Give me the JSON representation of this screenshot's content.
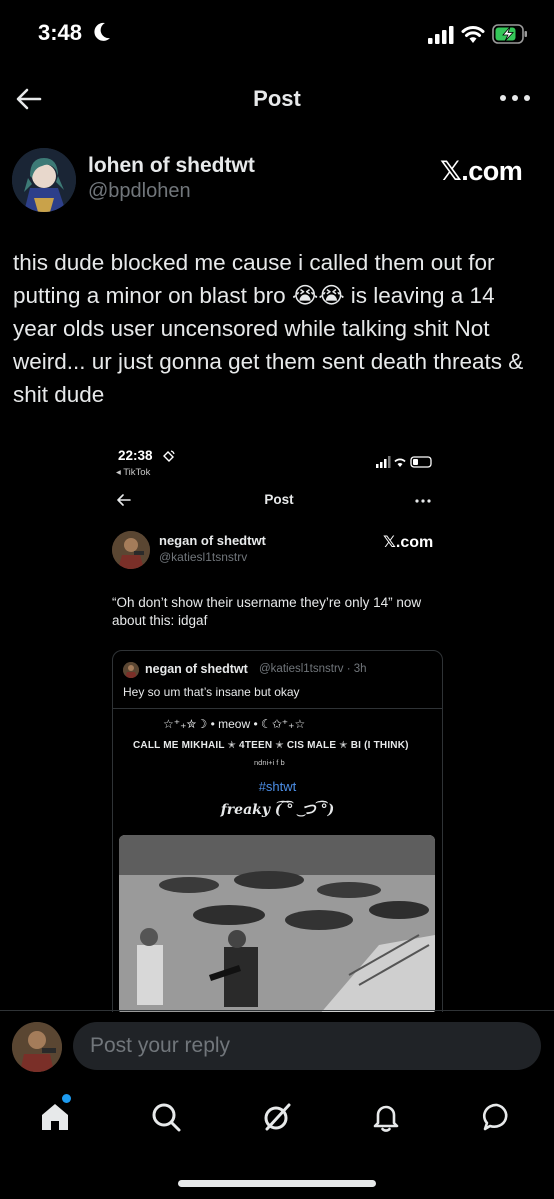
{
  "status_bar": {
    "time": "3:48"
  },
  "header": {
    "title": "Post"
  },
  "post": {
    "author_name": "lohen of shedtwt",
    "author_handle": "@bpdlohen",
    "source_label": "𝕏.com",
    "text": "this dude blocked me cause i called them out for putting a minor on blast bro 😭😭 is leaving a 14 year olds user uncensored while talking shit Not weird... ur just gonna get them sent death threats & shit dude"
  },
  "embedded_screenshot": {
    "time": "22:38",
    "back_app": "◂ TikTok",
    "header_title": "Post",
    "author_name": "negan of shedtwt",
    "author_handle": "@katiesl1tsnstrv",
    "source_label": "𝕏.com",
    "text": "“Oh don’t show their username they’re only 14” now about this: idgaf",
    "quote": {
      "author_name": "negan of shedtwt",
      "meta": "@katiesl1tsnstrv · 3h",
      "text": "Hey so um that’s insane but okay",
      "bio_line1": "☆⁺₊✮☽ • meow • ☾✩⁺₊☆",
      "bio_line2": "CALL ME MIKHAIL ✭ 4TEEN ✭ CIS MALE ✭ BI (I THINK)",
      "bio_line3": "ndni+i f b",
      "hashtag": "#shtwt",
      "freaky": "freaky (͡ ͡° ͜ つ ͡͡°)"
    }
  },
  "reply": {
    "placeholder": "Post your reply"
  },
  "nav": {
    "items": [
      "home",
      "search",
      "grok",
      "notifications",
      "messages"
    ],
    "accent": "#1d9bf0"
  },
  "colors": {
    "background": "#000000",
    "text_primary": "#e7e9ea",
    "text_secondary": "#71767b",
    "hashtag": "#4c8ee6",
    "battery_green": "#34c759"
  }
}
